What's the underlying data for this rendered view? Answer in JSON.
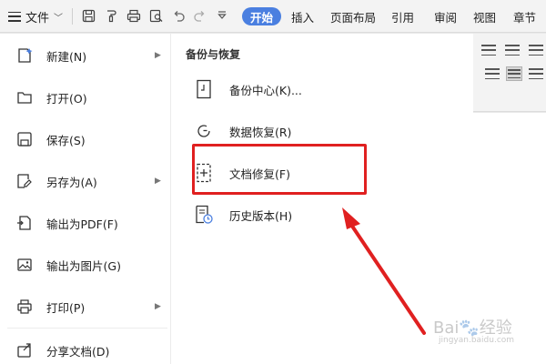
{
  "toolbar": {
    "file_menu_label": "文件",
    "tabs": [
      "开始",
      "插入",
      "页面布局",
      "引用",
      "审阅",
      "视图",
      "章节"
    ]
  },
  "file_menu": {
    "items": [
      {
        "label": "新建(N)",
        "icon": "new-document-icon",
        "has_submenu": true
      },
      {
        "label": "打开(O)",
        "icon": "folder-open-icon",
        "has_submenu": false
      },
      {
        "label": "保存(S)",
        "icon": "save-icon",
        "has_submenu": false
      },
      {
        "label": "另存为(A)",
        "icon": "save-as-icon",
        "has_submenu": true
      },
      {
        "label": "输出为PDF(F)",
        "icon": "export-pdf-icon",
        "has_submenu": false
      },
      {
        "label": "输出为图片(G)",
        "icon": "export-image-icon",
        "has_submenu": false
      },
      {
        "label": "打印(P)",
        "icon": "print-icon",
        "has_submenu": true
      },
      {
        "label": "分享文档(D)",
        "icon": "share-icon",
        "has_submenu": false
      }
    ]
  },
  "backup_panel": {
    "title": "备份与恢复",
    "items": [
      {
        "label": "备份中心(K)...",
        "icon": "backup-center-icon"
      },
      {
        "label": "数据恢复(R)",
        "icon": "data-recovery-icon"
      },
      {
        "label": "文档修复(F)",
        "icon": "document-repair-icon"
      },
      {
        "label": "历史版本(H)",
        "icon": "version-history-icon"
      }
    ]
  },
  "watermark": {
    "main": "Bai🐾经验",
    "sub": "jingyan.baidu.com"
  },
  "colors": {
    "accent": "#4a7fe0",
    "highlight": "#e02020"
  }
}
